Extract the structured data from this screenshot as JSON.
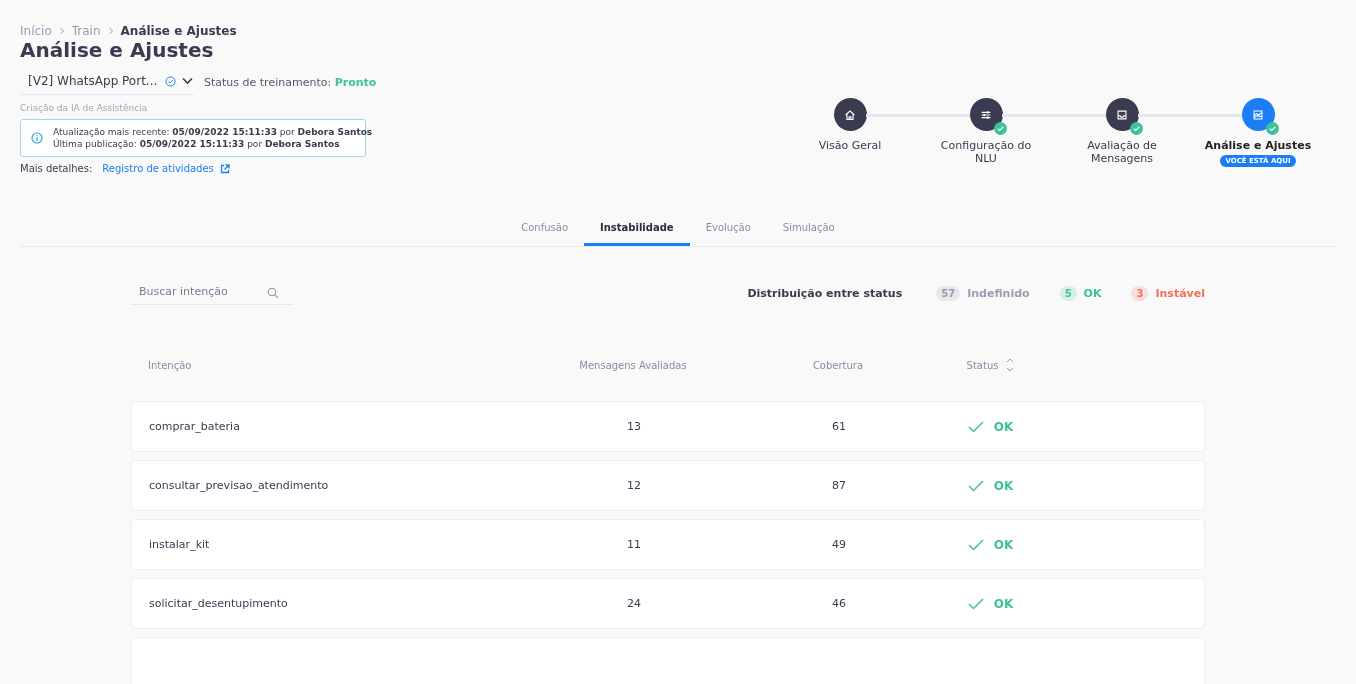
{
  "breadcrumb": [
    {
      "label": "Início"
    },
    {
      "label": "Train"
    },
    {
      "label": "Análise e Ajustes"
    }
  ],
  "title": "Análise e Ajustes",
  "bot_select": {
    "value": "[V2] WhatsApp Port..."
  },
  "training_status": {
    "label": "Status de treinamento:",
    "value": "Pronto"
  },
  "subtitle": "Criação da IA de Assistência",
  "info": {
    "lines": [
      "Atualização mais recente: **05/09/2022 15:11:33** por **Debora Santos**",
      "Última publicação: **05/09/2022 15:11:33** por **Debora Santos**"
    ]
  },
  "details": {
    "label": "Mais detalhes:",
    "link": "Registro de atividades"
  },
  "steps": [
    {
      "label": "Visão Geral",
      "done": false,
      "selected": false
    },
    {
      "label": "Configuração do NLU",
      "done": true,
      "selected": false
    },
    {
      "label": "Avaliação de Mensagens",
      "done": true,
      "selected": false
    },
    {
      "label": "Análise e Ajustes",
      "done": true,
      "selected": true,
      "badge": "VOCÊ ESTÁ AQUI"
    }
  ],
  "tabs": [
    {
      "label": "Confusão",
      "selected": false
    },
    {
      "label": "Instabilidade",
      "selected": true
    },
    {
      "label": "Evolução",
      "selected": false
    },
    {
      "label": "Simulação",
      "selected": false
    }
  ],
  "search": {
    "placeholder": "Buscar intenção"
  },
  "distribution": {
    "title": "Distribuição entre status",
    "items": [
      {
        "count": "57",
        "label": "Indefinido",
        "color": "#9a9cb0"
      },
      {
        "count": "5",
        "label": "OK",
        "color": "#3fc29a"
      },
      {
        "count": "3",
        "label": "Instável",
        "color": "#f2715a"
      }
    ]
  },
  "table": {
    "columns": [
      "Intenção",
      "Mensagens Avaliadas",
      "Cobertura",
      "Status"
    ],
    "rows": [
      {
        "intent": "comprar_bateria",
        "evaluated": "13",
        "coverage": "61",
        "status": {
          "kind": "ok",
          "label": "OK"
        }
      },
      {
        "intent": "consultar_previsao_atendimento",
        "evaluated": "12",
        "coverage": "87",
        "status": {
          "kind": "ok",
          "label": "OK"
        }
      },
      {
        "intent": "instalar_kit",
        "evaluated": "11",
        "coverage": "49",
        "status": {
          "kind": "ok",
          "label": "OK"
        }
      },
      {
        "intent": "solicitar_desentupimento",
        "evaluated": "24",
        "coverage": "46",
        "status": {
          "kind": "ok",
          "label": "OK"
        }
      }
    ]
  }
}
